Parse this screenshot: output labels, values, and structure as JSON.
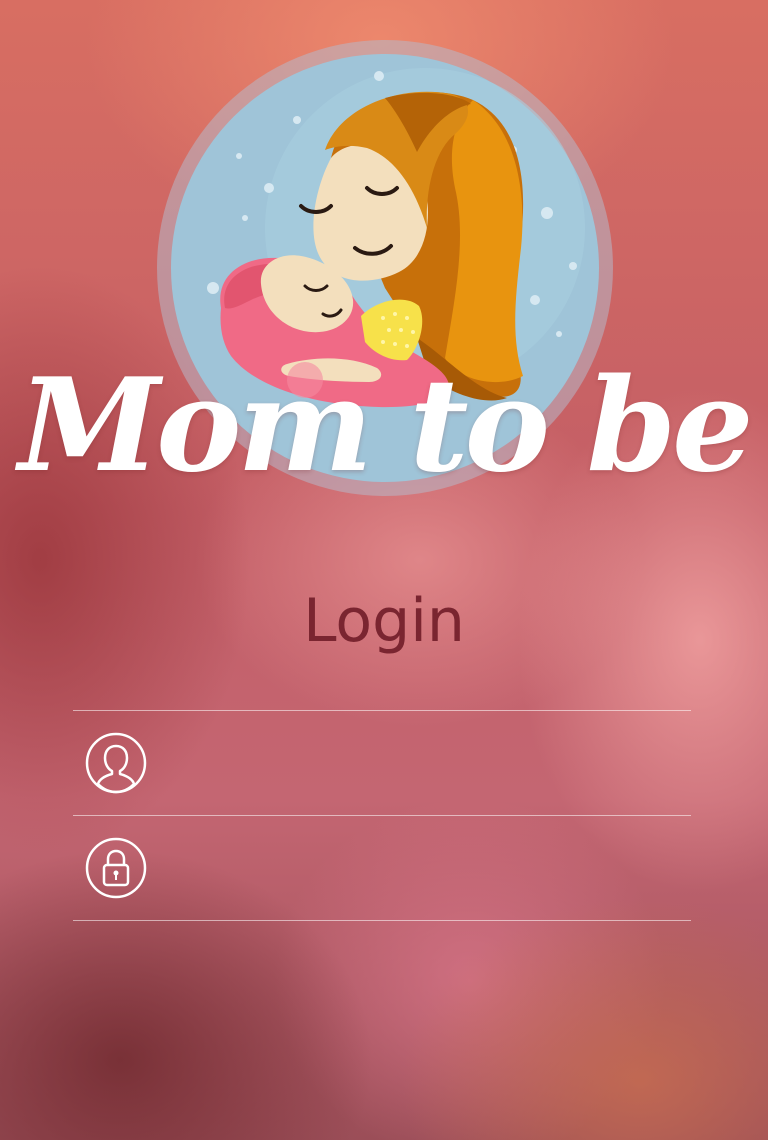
{
  "app": {
    "title": "Mom to be"
  },
  "login": {
    "heading": "Login",
    "username_field": {
      "value": "",
      "placeholder": "",
      "icon": "user-icon"
    },
    "password_field": {
      "value": "",
      "placeholder": "",
      "icon": "lock-icon"
    }
  },
  "colors": {
    "heading": "#7a2530",
    "logo_circle": "#9fc4d8",
    "hair": "#d98a16",
    "skin": "#f3dfbd",
    "baby_wrap": "#f06a86",
    "onesie": "#f7e14a"
  }
}
